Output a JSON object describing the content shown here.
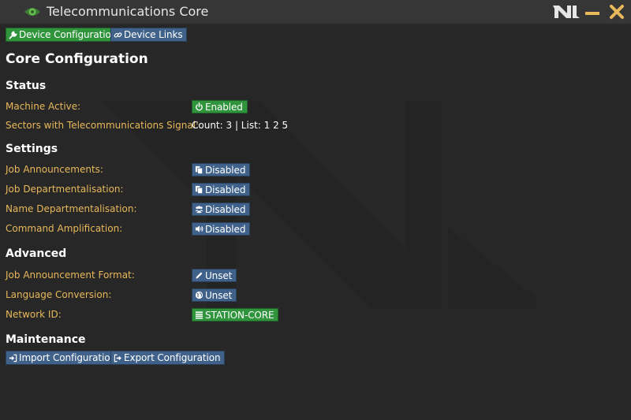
{
  "window": {
    "title": "Telecommunications Core",
    "minimize_icon": "minimize-icon",
    "close_icon": "close-icon",
    "logo_icon": "nt-logo-icon",
    "accent_color": "#e8b85a"
  },
  "tabs": [
    {
      "label": "Device Configuration",
      "icon": "wrench-icon",
      "selected": true
    },
    {
      "label": "Device Links",
      "icon": "link-icon",
      "selected": false
    }
  ],
  "page_title": "Core Configuration",
  "status": {
    "heading": "Status",
    "machine_active": {
      "label": "Machine Active:",
      "value": "Enabled",
      "icon": "power-icon"
    },
    "sectors": {
      "label": "Sectors with Telecommunications Signal:",
      "value": "Count: 3 | List: 1 2 5"
    }
  },
  "settings": {
    "heading": "Settings",
    "items": [
      {
        "label": "Job Announcements:",
        "value": "Disabled",
        "icon": "copy-icon"
      },
      {
        "label": "Job Departmentalisation:",
        "value": "Disabled",
        "icon": "copy-icon"
      },
      {
        "label": "Name Departmentalisation:",
        "value": "Disabled",
        "icon": "users-icon"
      },
      {
        "label": "Command Amplification:",
        "value": "Disabled",
        "icon": "volume-icon"
      }
    ]
  },
  "advanced": {
    "heading": "Advanced",
    "items": [
      {
        "label": "Job Announcement Format:",
        "value": "Unset",
        "icon": "pencil-icon"
      },
      {
        "label": "Language Conversion:",
        "value": "Unset",
        "icon": "globe-icon"
      },
      {
        "label": "Network ID:",
        "value": "STATION-CORE",
        "icon": "list-icon"
      }
    ]
  },
  "maintenance": {
    "heading": "Maintenance",
    "import_label": "Import Configuration",
    "export_label": "Export Configuration"
  },
  "colors": {
    "button_blue": "#40628a",
    "button_green": "#2f943c",
    "background": "#272727",
    "titlebar": "#363636"
  }
}
